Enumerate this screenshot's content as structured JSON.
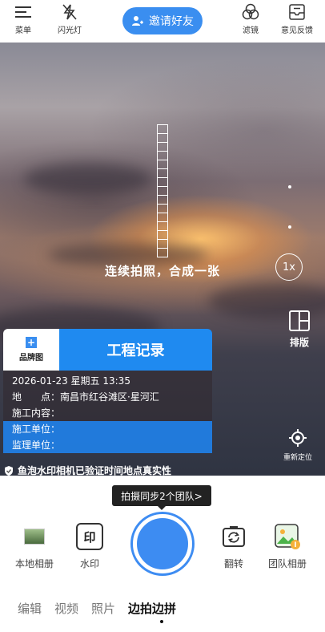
{
  "topbar": {
    "menu_label": "菜单",
    "flash_label": "闪光灯",
    "invite_label": "邀请好友",
    "filter_label": "滤镜",
    "feedback_label": "意见反馈"
  },
  "viewfinder": {
    "continuous_hint": "连续拍照，合成一张",
    "zoom_label": "1x",
    "layout_label": "排版",
    "relocate_label": "重新定位"
  },
  "watermark": {
    "brand_label": "品牌图",
    "title": "工程记录",
    "datetime": "2026-01-23 星期五 13:35",
    "location": "地　　点：南昌市红谷滩区·星河汇",
    "content": "施工内容：",
    "company": "施工单位：",
    "supervisor": "监理单位：",
    "verified_text": "鱼泡水印相机已验证时间地点真实性"
  },
  "sync_tip": "拍摄同步2个团队>",
  "bottom": {
    "album_label": "本地相册",
    "watermark_label": "水印",
    "watermark_glyph": "印",
    "flip_label": "翻转",
    "team_album_label": "团队相册"
  },
  "modes": [
    "编辑",
    "视频",
    "照片",
    "边拍边拼"
  ],
  "colors": {
    "accent": "#3a8ef0",
    "watermark_title_bg": "#1f8af0"
  }
}
